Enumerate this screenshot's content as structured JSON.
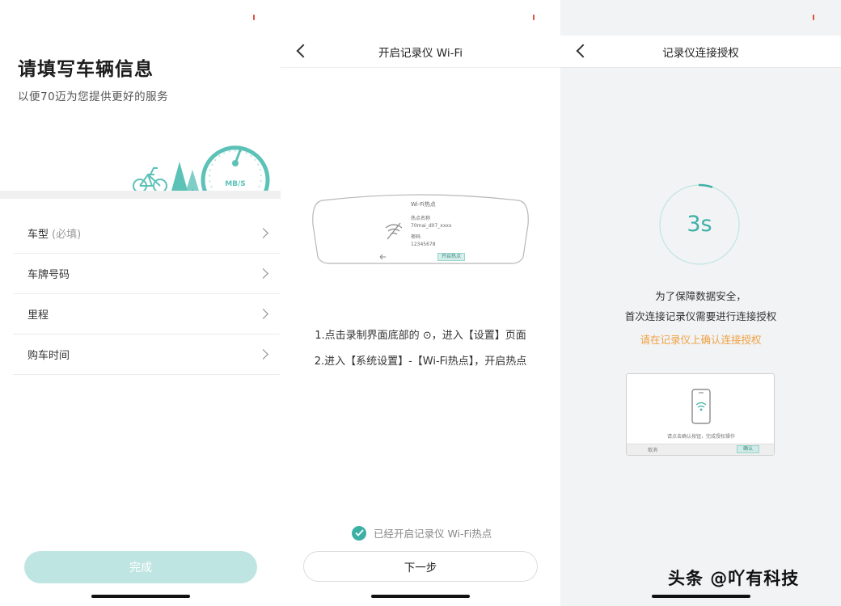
{
  "screen1": {
    "title": "请填写车辆信息",
    "subtitle": "以便70迈为您提供更好的服务",
    "speedometer_label": "MB/S",
    "rows": [
      {
        "label": "车型",
        "hint": "(必填)"
      },
      {
        "label": "车牌号码",
        "hint": ""
      },
      {
        "label": "里程",
        "hint": ""
      },
      {
        "label": "购车时间",
        "hint": ""
      }
    ],
    "done_label": "完成"
  },
  "screen2": {
    "nav_title": "开启记录仪 Wi-Fi",
    "mirror": {
      "header": "Wi-Fi热点",
      "name_label": "热点名称",
      "name_value": "70mai_d07_xxxx",
      "password_label": "密码",
      "password_value": "12345678",
      "button_label": "开启热点"
    },
    "instruction_1": "1.点击录制界面底部的 ⊙，进入【设置】页面",
    "instruction_2": "2.进入【系统设置】-【Wi-Fi热点】，开启热点",
    "checkbox_label": "已经开启记录仪 Wi-Fi热点",
    "next_label": "下一步"
  },
  "screen3": {
    "nav_title": "记录仪连接授权",
    "countdown": "3s",
    "countdown_progress": 0.05,
    "line_1": "为了保障数据安全，",
    "line_2": "首次连接记录仪需要进行连接授权",
    "warning": "请在记录仪上确认连接授权",
    "card_hint": "请点击确认按钮，完成授权操作",
    "card_cancel": "取消",
    "card_confirm": "确认"
  },
  "watermark": "头条 @吖有科技",
  "colors": {
    "accent": "#3db0a6",
    "accent_light": "#bfe5e2",
    "warning": "#f0a040",
    "status_dot": "#e0503c"
  }
}
